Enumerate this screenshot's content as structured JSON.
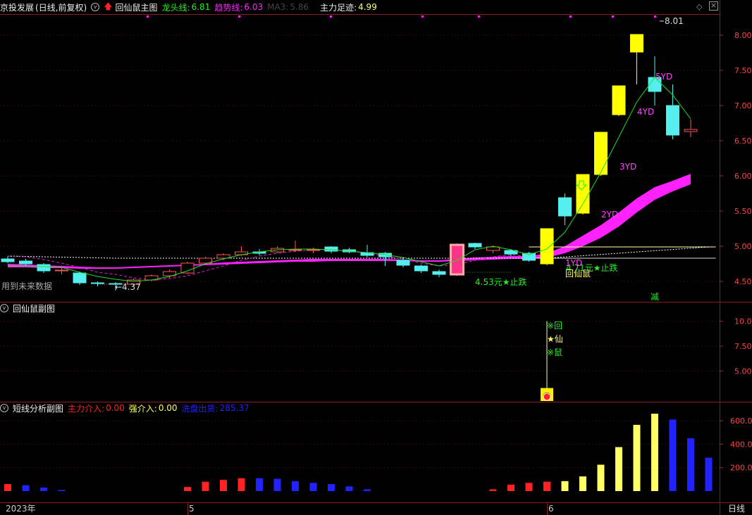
{
  "header": {
    "stock_name": "京投发展",
    "period": "(日线,前复权)",
    "main_indicator": "回仙鼠主图",
    "legend": [
      {
        "label": "龙头线:",
        "value": "6.81",
        "color": "#22ee22"
      },
      {
        "label": "趋势线:",
        "value": "6.03",
        "color": "#ff22ff"
      },
      {
        "label": "MA3:",
        "value": "5.86",
        "color": "#444444"
      },
      {
        "label": "主力足迹:",
        "value": "4.99",
        "color": "#eeeeee"
      }
    ]
  },
  "sub1": {
    "title": "回仙鼠副图",
    "marks": [
      "※回",
      "★仙",
      "※鼠"
    ]
  },
  "sub2": {
    "title": "短线分析副图",
    "legend": [
      {
        "label": "主力介入:",
        "value": "0.00",
        "color": "#ff2222"
      },
      {
        "label": "强介入:",
        "value": "0.00",
        "color": "#ffff66"
      },
      {
        "label": "洗盘出货:",
        "value": "285.37",
        "color": "#2222ff"
      }
    ]
  },
  "notes": {
    "future_data": "用到未来数据",
    "low_label": "←4.37",
    "high_label": "8.01",
    "stop1": "4.53元★止跌",
    "stop2": "4.71元★止跌",
    "huixianshu": "回仙鼠",
    "jian": "减",
    "yd_labels": [
      "1YD",
      "2YD",
      "3YD",
      "4YD",
      "5YD"
    ]
  },
  "x_axis": {
    "labels": [
      "2023年",
      "5",
      "6"
    ],
    "period_button": "日线"
  },
  "chart_data": [
    {
      "type": "candlestick",
      "yaxis_ticks": [
        4.5,
        5.0,
        5.5,
        6.0,
        6.5,
        7.0,
        7.5,
        8.0
      ],
      "ylim": [
        4.22,
        8.3
      ],
      "candles": [
        [
          4.82,
          4.78,
          4.86,
          4.76
        ],
        [
          4.79,
          4.75,
          4.82,
          4.72
        ],
        [
          4.74,
          4.65,
          4.76,
          4.62
        ],
        [
          4.66,
          4.66,
          4.7,
          4.6
        ],
        [
          4.62,
          4.48,
          4.64,
          4.45
        ],
        [
          4.48,
          4.47,
          4.5,
          4.43
        ],
        [
          4.47,
          4.46,
          4.49,
          4.37
        ],
        [
          4.46,
          4.52,
          4.54,
          4.44
        ],
        [
          4.52,
          4.58,
          4.6,
          4.5
        ],
        [
          4.58,
          4.64,
          4.67,
          4.55
        ],
        [
          4.62,
          4.76,
          4.78,
          4.6
        ],
        [
          4.76,
          4.83,
          4.85,
          4.74
        ],
        [
          4.83,
          4.88,
          4.9,
          4.8
        ],
        [
          4.88,
          4.92,
          5.0,
          4.86
        ],
        [
          4.92,
          4.9,
          4.96,
          4.87
        ],
        [
          4.92,
          4.97,
          5.0,
          4.9
        ],
        [
          4.95,
          4.95,
          5.08,
          4.92
        ],
        [
          4.95,
          4.95,
          4.98,
          4.9
        ],
        [
          4.99,
          4.93,
          5.0,
          4.9
        ],
        [
          4.95,
          4.92,
          4.98,
          4.9
        ],
        [
          4.91,
          4.87,
          5.02,
          4.84
        ],
        [
          4.9,
          4.85,
          4.92,
          4.72
        ],
        [
          4.8,
          4.73,
          4.82,
          4.7
        ],
        [
          4.72,
          4.65,
          4.74,
          4.62
        ],
        [
          4.64,
          4.6,
          4.67,
          4.56
        ],
        [
          4.6,
          5.02,
          5.04,
          4.58
        ],
        [
          5.04,
          4.99,
          5.05,
          4.96
        ],
        [
          4.94,
          4.99,
          5.01,
          4.9
        ],
        [
          4.94,
          4.89,
          4.96,
          4.86
        ],
        [
          4.9,
          4.8,
          4.92,
          4.78
        ],
        [
          4.75,
          5.25,
          5.25,
          4.73
        ],
        [
          5.69,
          5.43,
          5.75,
          5.3
        ],
        [
          5.47,
          6.02,
          6.02,
          5.45
        ],
        [
          6.02,
          6.62,
          6.62,
          6.0
        ],
        [
          6.87,
          7.28,
          7.28,
          6.85
        ],
        [
          7.76,
          8.01,
          8.01,
          7.3
        ],
        [
          7.4,
          7.2,
          7.7,
          7.0
        ],
        [
          7.0,
          6.58,
          7.3,
          6.52
        ],
        [
          6.63,
          6.66,
          6.8,
          6.55
        ]
      ],
      "trend_upper": [
        4.75,
        4.74,
        4.73,
        4.72,
        4.71,
        4.7,
        4.7,
        4.71,
        4.72,
        4.73,
        4.74,
        4.75,
        4.77,
        4.78,
        4.79,
        4.8,
        4.81,
        4.82,
        4.82,
        4.82,
        4.82,
        4.82,
        4.81,
        4.8,
        4.8,
        4.82,
        4.84,
        4.85,
        4.86,
        4.86,
        4.9,
        5.0,
        5.15,
        5.3,
        5.48,
        5.68,
        5.84,
        5.93,
        6.03
      ],
      "trend_lower": [
        4.7,
        4.7,
        4.69,
        4.69,
        4.68,
        4.68,
        4.68,
        4.69,
        4.7,
        4.71,
        4.72,
        4.73,
        4.74,
        4.75,
        4.76,
        4.77,
        4.78,
        4.78,
        4.79,
        4.79,
        4.79,
        4.79,
        4.79,
        4.78,
        4.78,
        4.79,
        4.8,
        4.81,
        4.82,
        4.82,
        4.84,
        4.9,
        5.0,
        5.12,
        5.28,
        5.48,
        5.66,
        5.78,
        5.88
      ],
      "dragon_line": [
        4.72,
        4.72,
        4.71,
        4.7,
        4.63,
        4.57,
        4.53,
        4.5,
        4.52,
        4.57,
        4.65,
        4.75,
        4.82,
        4.88,
        4.92,
        4.95,
        4.96,
        4.96,
        4.95,
        4.93,
        4.91,
        4.88,
        4.84,
        4.78,
        4.72,
        4.8,
        4.95,
        5.0,
        4.95,
        4.88,
        4.96,
        5.2,
        5.6,
        6.05,
        6.55,
        7.05,
        7.4,
        7.15,
        6.81
      ],
      "ma_dashed": [
        4.86,
        4.85,
        4.81,
        4.76,
        4.7,
        4.63,
        4.6,
        4.55,
        4.52,
        4.54,
        4.58,
        4.65,
        4.72,
        4.8,
        4.86,
        4.9,
        4.93,
        4.95,
        4.95,
        4.93,
        4.9,
        4.86,
        4.82,
        4.76,
        4.72,
        4.74,
        4.8,
        4.85,
        4.88,
        4.85,
        4.85,
        4.95,
        5.15,
        5.5,
        5.9,
        6.4,
        6.9,
        7.2,
        7.45
      ],
      "support_line": 4.83,
      "baseline_dashed": [
        4.84,
        4.84,
        5.0
      ],
      "footprint_line": 4.99
    },
    {
      "type": "bar",
      "yaxis_ticks": [
        5.0,
        7.5,
        10.0
      ],
      "ylim": [
        2.0,
        10.8
      ],
      "signal": {
        "bar_index": 30,
        "value": 10.0,
        "box_value": 3.3
      }
    },
    {
      "type": "bar",
      "yaxis_ticks": [
        200,
        400,
        600
      ],
      "ylim": [
        0,
        720
      ],
      "bars": [
        {
          "i": 0,
          "v": 60,
          "c": "#ff2222"
        },
        {
          "i": 1,
          "v": 50,
          "c": "#2222ff"
        },
        {
          "i": 2,
          "v": 30,
          "c": "#2222ff"
        },
        {
          "i": 3,
          "v": 10,
          "c": "#2222ff"
        },
        {
          "i": 10,
          "v": 35,
          "c": "#ff2222"
        },
        {
          "i": 11,
          "v": 80,
          "c": "#ff2222"
        },
        {
          "i": 12,
          "v": 95,
          "c": "#ff2222"
        },
        {
          "i": 13,
          "v": 110,
          "c": "#ff2222"
        },
        {
          "i": 14,
          "v": 110,
          "c": "#2222ff"
        },
        {
          "i": 15,
          "v": 105,
          "c": "#2222ff"
        },
        {
          "i": 16,
          "v": 85,
          "c": "#2222ff"
        },
        {
          "i": 17,
          "v": 70,
          "c": "#2222ff"
        },
        {
          "i": 18,
          "v": 60,
          "c": "#2222ff"
        },
        {
          "i": 19,
          "v": 40,
          "c": "#2222ff"
        },
        {
          "i": 20,
          "v": 15,
          "c": "#2222ff"
        },
        {
          "i": 27,
          "v": 15,
          "c": "#ff2222"
        },
        {
          "i": 28,
          "v": 55,
          "c": "#ff2222"
        },
        {
          "i": 29,
          "v": 70,
          "c": "#ff2222"
        },
        {
          "i": 30,
          "v": 80,
          "c": "#ff2222"
        },
        {
          "i": 31,
          "v": 85,
          "c": "#ffff66"
        },
        {
          "i": 32,
          "v": 125,
          "c": "#ffff66"
        },
        {
          "i": 33,
          "v": 225,
          "c": "#ffff66"
        },
        {
          "i": 34,
          "v": 375,
          "c": "#ffff66"
        },
        {
          "i": 35,
          "v": 565,
          "c": "#ffff66"
        },
        {
          "i": 36,
          "v": 660,
          "c": "#ffff66"
        },
        {
          "i": 37,
          "v": 610,
          "c": "#2222ff"
        },
        {
          "i": 38,
          "v": 450,
          "c": "#2222ff"
        },
        {
          "i": 39,
          "v": 285,
          "c": "#2222ff"
        }
      ]
    }
  ]
}
